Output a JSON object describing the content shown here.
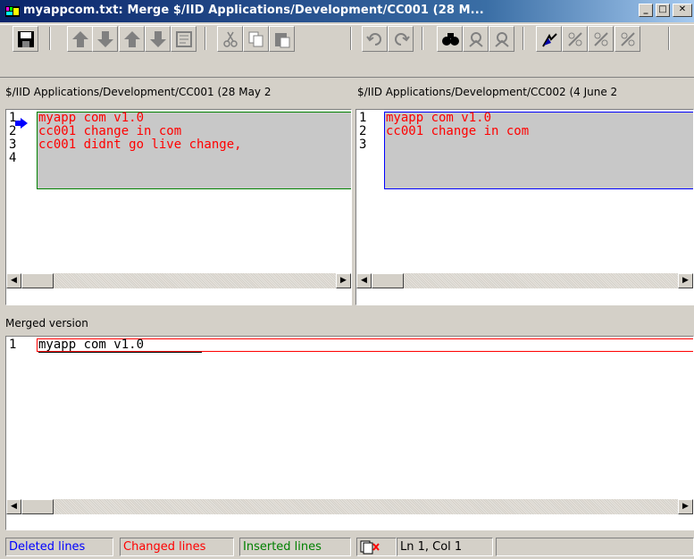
{
  "window": {
    "title": "myappcom.txt: Merge $/IID Applications/Development/CC001 (28 M...",
    "controls": [
      "minimize",
      "maximize",
      "close"
    ]
  },
  "toolbar": {
    "buttons": [
      {
        "name": "save-icon"
      },
      {
        "name": "previous-change-icon"
      },
      {
        "name": "next-change-icon"
      },
      {
        "name": "previous-conflict-icon"
      },
      {
        "name": "next-conflict-icon"
      },
      {
        "name": "resolve-icon"
      },
      {
        "name": "cut-icon"
      },
      {
        "name": "copy-icon"
      },
      {
        "name": "paste-icon"
      },
      {
        "name": "undo-icon"
      },
      {
        "name": "redo-icon"
      },
      {
        "name": "find-icon"
      },
      {
        "name": "accept-left-icon"
      },
      {
        "name": "accept-right-icon"
      },
      {
        "name": "flag-icon"
      },
      {
        "name": "apply-change-icon"
      },
      {
        "name": "apply-change-2-icon"
      },
      {
        "name": "apply-change-3-icon"
      }
    ]
  },
  "left_pane": {
    "header": "$/IID Applications/Development/CC001 (28 May 2",
    "line_numbers": [
      "1",
      "2",
      "3",
      "4"
    ],
    "lines": [
      "myapp com v1.0",
      "cc001 change in com",
      "cc001 didnt go live change,"
    ]
  },
  "right_pane": {
    "header": "$/IID Applications/Development/CC002 (4 June 2",
    "line_numbers": [
      "1",
      "2",
      "3"
    ],
    "lines": [
      "myapp com v1.0",
      "cc001 change in com"
    ]
  },
  "merged": {
    "label": "Merged version",
    "line_numbers": [
      "1"
    ],
    "lines": [
      "myapp com v1.0"
    ]
  },
  "status": {
    "deleted": "Deleted lines",
    "changed": "Changed lines",
    "inserted": "Inserted lines",
    "position": "Ln 1, Col 1"
  },
  "colors": {
    "deleted": "#0000ff",
    "changed": "#ff0000",
    "inserted": "#008000",
    "left_highlight_border": "#008000",
    "right_highlight_border": "#0000ff",
    "merged_highlight_border": "#ff0000"
  }
}
